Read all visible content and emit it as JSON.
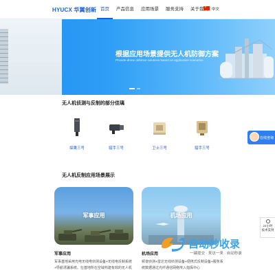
{
  "header": {
    "logo": "HYUCX 华翼创新",
    "nav": [
      "首页",
      "产品信息",
      "应用场景",
      "服务支持",
      "关于我们"
    ],
    "active_nav": 0,
    "language": "中文"
  },
  "banner": {
    "title": "根据应用场景提供无人机防御方案",
    "subtitle": "Provide drone defense solutions based on application scenarios",
    "slide_count": 2,
    "active_slide": 0
  },
  "products_section": {
    "title": "无人机侦测与反制的部分佳璃",
    "items": [
      {
        "label": "探鹰三号",
        "icon": "detector-antenna-icon"
      },
      {
        "label": "猎手三号",
        "icon": "jammer-gun-icon"
      },
      {
        "label": "卫士三号",
        "icon": "shield-device-icon"
      },
      {
        "label": "猎手三号",
        "icon": "handheld-jammer-icon"
      }
    ]
  },
  "float_service": {
    "label": "在线咨询"
  },
  "scenes_section": {
    "title": "无人机反制应用场景展示",
    "cards": [
      {
        "label": "军事应用",
        "caption": "军事应用",
        "desc": "军事基地采用光电无线电侦测设备+无线电反制系统+导航诱骗系统。在基地所在空域构建有效的无人机"
      },
      {
        "label": "机场应用",
        "caption": "机场应用",
        "desc": "频谱侦测+雷达无线侦测设备+便携式反制设备+服务系统数据通过光纤通信网络传入指挥中心"
      }
    ]
  },
  "side_tool": {
    "line1": "24小时",
    "line2": "技术支持"
  },
  "watermark": {
    "title": "自动秒收录",
    "subtitle": "一键提交 · 来访一来 · 自动秒录"
  },
  "colors": {
    "accent": "#1e5fd8",
    "banner": "#2e9ef6"
  }
}
